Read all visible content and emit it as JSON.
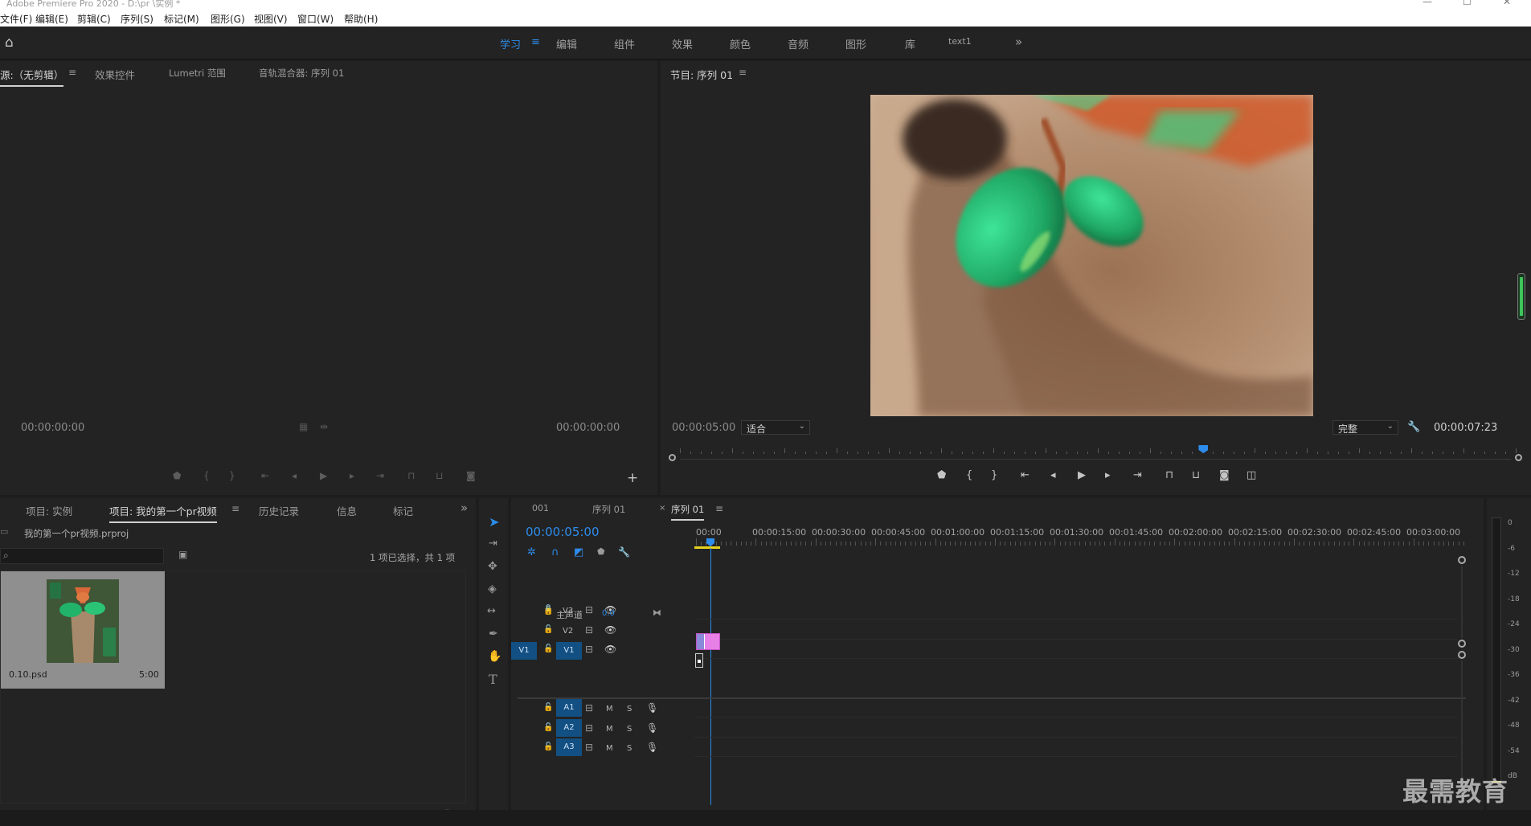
{
  "app": {
    "title": "Adobe Premiere Pro 2020 - D:\\pr \\实例 *"
  },
  "menu": [
    "文件(F)",
    "编辑(E)",
    "剪辑(C)",
    "序列(S)",
    "标记(M)",
    "图形(G)",
    "视图(V)",
    "窗口(W)",
    "帮助(H)"
  ],
  "workspaces": {
    "items": [
      "学习",
      "编辑",
      "组件",
      "效果",
      "颜色",
      "音频",
      "图形",
      "库",
      "text1"
    ],
    "active": "学习",
    "more": "»"
  },
  "source_panel": {
    "tabs": [
      "源:（无剪辑）",
      "效果控件",
      "Lumetri 范围",
      "音轨混合器: 序列 01"
    ],
    "timecode_left": "00:00:00:00",
    "timecode_right": "00:00:00:00"
  },
  "program_panel": {
    "tab": "节目: 序列 01",
    "timecode": "00:00:05:00",
    "fit": "适合",
    "quality": "完整",
    "duration": "00:00:07:23",
    "playhead_fraction": 0.63
  },
  "project_panel": {
    "tabs": [
      "项目: 实例",
      "项目: 我的第一个pr视频",
      "历史记录",
      "信息",
      "标记"
    ],
    "active_tab": "项目: 我的第一个pr视频",
    "project_file": "我的第一个pr视频.prproj",
    "selection_info": "1 项已选择，共 1 项",
    "item": {
      "name": "0.10.psd",
      "duration": "5:00"
    }
  },
  "timeline": {
    "tabs": [
      "001",
      "序列 01",
      "序列 01"
    ],
    "active_tab": "序列 01",
    "close_glyph": "×",
    "timecode": "00:00:05:00",
    "ruler": [
      "00:00",
      "00:00:15:00",
      "00:00:30:00",
      "00:00:45:00",
      "00:01:00:00",
      "00:01:15:00",
      "00:01:30:00",
      "00:01:45:00",
      "00:02:00:00",
      "00:02:15:00",
      "00:02:30:00",
      "00:02:45:00",
      "00:03:00:00"
    ],
    "video_tracks": [
      "V3",
      "V2",
      "V1"
    ],
    "audio_tracks": [
      "A1",
      "A2",
      "A3"
    ],
    "source_patch": "V1",
    "master": {
      "label": "主声道",
      "value": "0.0"
    },
    "m_label": "M",
    "s_label": "S"
  },
  "meters": [
    "0",
    "-6",
    "-12",
    "-18",
    "-24",
    "-30",
    "-36",
    "-42",
    "-48",
    "-54",
    "dB"
  ],
  "watermark": "最需教育",
  "colors": {
    "accent": "#2d8ceb",
    "track_target": "#124f82",
    "clip": "#e680e6",
    "panel_bg": "#232323"
  }
}
